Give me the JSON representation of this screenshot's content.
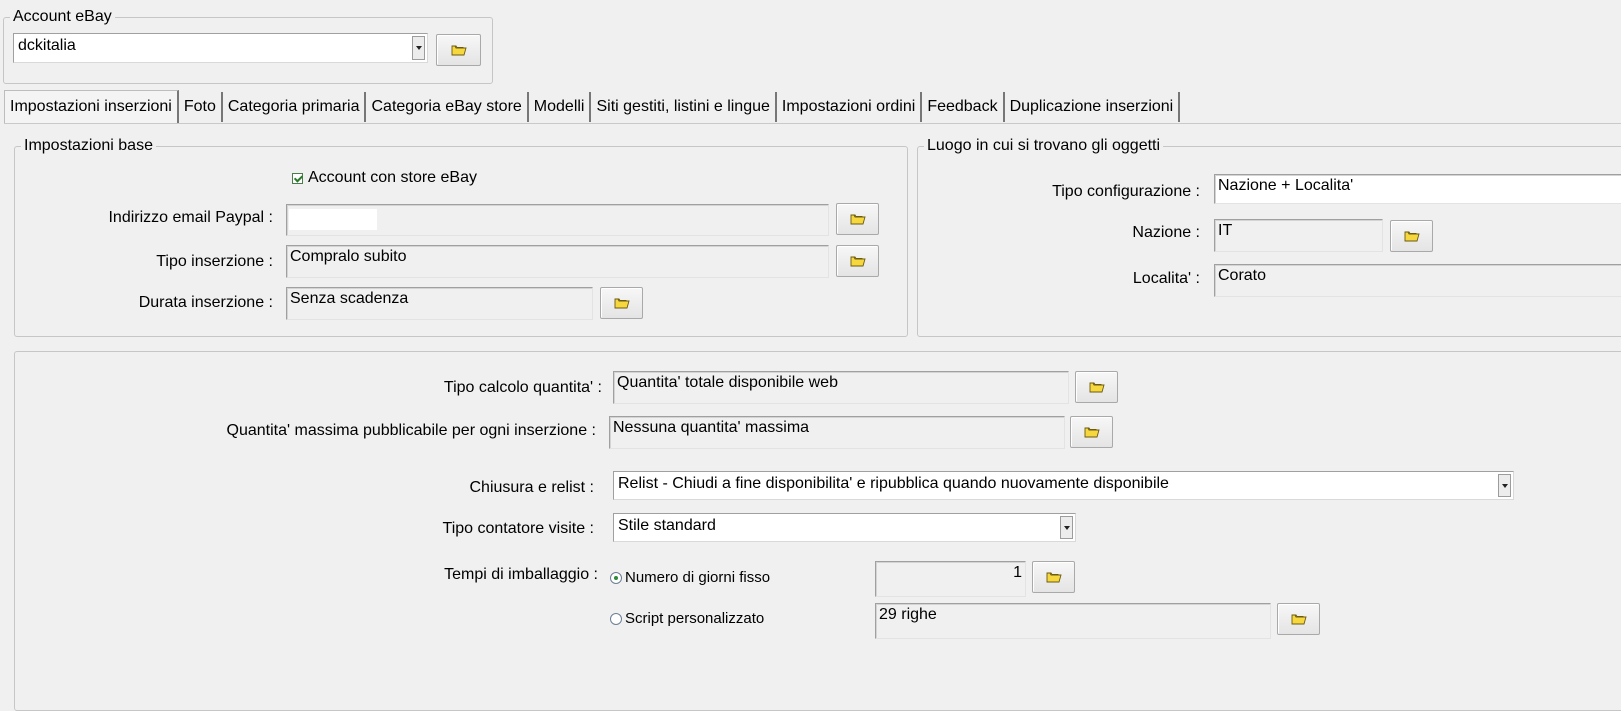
{
  "account": {
    "legend": "Account eBay",
    "selected": "dckitalia"
  },
  "tabs": [
    {
      "label": "Impostazioni inserzioni",
      "active": true
    },
    {
      "label": "Foto"
    },
    {
      "label": "Categoria primaria"
    },
    {
      "label": "Categoria eBay store"
    },
    {
      "label": "Modelli"
    },
    {
      "label": "Siti gestiti, listini e lingue"
    },
    {
      "label": "Impostazioni ordini"
    },
    {
      "label": "Feedback"
    },
    {
      "label": "Duplicazione inserzioni"
    }
  ],
  "base": {
    "legend": "Impostazioni base",
    "store_checkbox_label": "Account con store eBay",
    "paypal_label": "Indirizzo email Paypal :",
    "paypal_value": "",
    "tipo_label": "Tipo inserzione :",
    "tipo_value": "Compralo subito",
    "durata_label": "Durata inserzione :",
    "durata_value": "Senza scadenza"
  },
  "luogo": {
    "legend": "Luogo in cui si trovano gli oggetti",
    "config_label": "Tipo configurazione :",
    "config_value": "Nazione + Localita'",
    "nazione_label": "Nazione :",
    "nazione_value": "IT",
    "localita_label": "Localita' :",
    "localita_value": "Corato"
  },
  "quantita": {
    "calcolo_label": "Tipo calcolo quantita' :",
    "calcolo_value": "Quantita' totale disponibile web",
    "massima_label": "Quantita' massima pubblicabile per ogni inserzione :",
    "massima_value": "Nessuna quantita' massima",
    "chiusura_label": "Chiusura e relist :",
    "chiusura_value": "Relist - Chiudi a fine disponibilita' e ripubblica quando nuovamente disponibile",
    "contatore_label": "Tipo contatore visite :",
    "contatore_value": "Stile standard",
    "imballaggio_label": "Tempi di imballaggio :",
    "radio_fisso_label": "Numero di giorni fisso",
    "radio_fisso_value": "1",
    "radio_script_label": "Script personalizzato",
    "radio_script_value": "29 righe"
  },
  "colors": {
    "background": "#f0f0f0",
    "folder_icon": "#f2d434"
  },
  "icons": {
    "browse_button": "folder-icon",
    "checkbox": "checkmark-icon"
  }
}
